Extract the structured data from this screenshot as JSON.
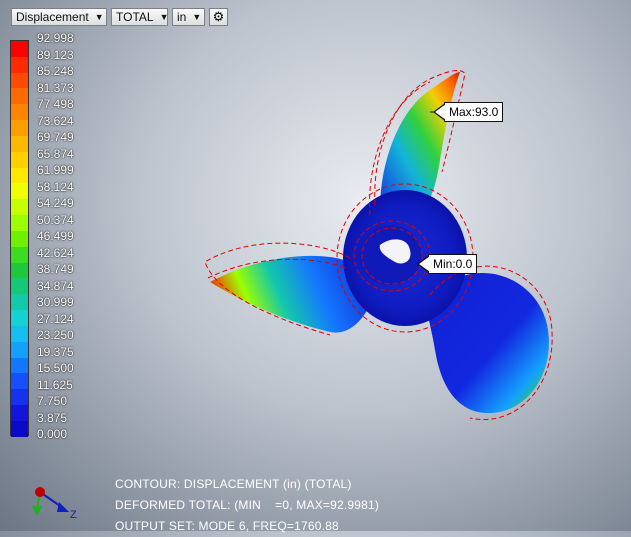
{
  "toolbar": {
    "result_select": "Displacement",
    "component_select": "TOTAL",
    "units_select": "in",
    "settings_icon": "gear-icon"
  },
  "legend": {
    "labels": [
      "92.998",
      "89.123",
      "85.248",
      "81.373",
      "77.498",
      "73.624",
      "69.749",
      "65.874",
      "61.999",
      "58.124",
      "54.249",
      "50.374",
      "46.499",
      "42.624",
      "38.749",
      "34.874",
      "30.999",
      "27.124",
      "23.250",
      "19.375",
      "15.500",
      "11.625",
      "7.750",
      "3.875",
      "0.000"
    ],
    "colors": [
      "#ff0000",
      "#ff2a00",
      "#ff4a00",
      "#ff6a00",
      "#ff8400",
      "#ff9e00",
      "#ffb800",
      "#ffd000",
      "#ffe800",
      "#f0ff00",
      "#c8ff00",
      "#9cff00",
      "#6ef000",
      "#3cdc1e",
      "#1ec83c",
      "#14c878",
      "#14c8aa",
      "#14d2d2",
      "#14bef0",
      "#14a0ff",
      "#1478ff",
      "#1450ff",
      "#1432f0",
      "#1414dc",
      "#0a0ac8"
    ]
  },
  "markers": {
    "max_label": "Max:93.0",
    "min_label": "Min:0.0"
  },
  "info": {
    "line1": "CONTOUR: DISPLACEMENT (in) (TOTAL)",
    "line2": "DEFORMED TOTAL: (MIN    =0, MAX=92.9981)",
    "line3": "OUTPUT SET: MODE 6, FREQ=1760.88"
  },
  "triad": {
    "y_label": "Y",
    "z_label": "Z"
  }
}
